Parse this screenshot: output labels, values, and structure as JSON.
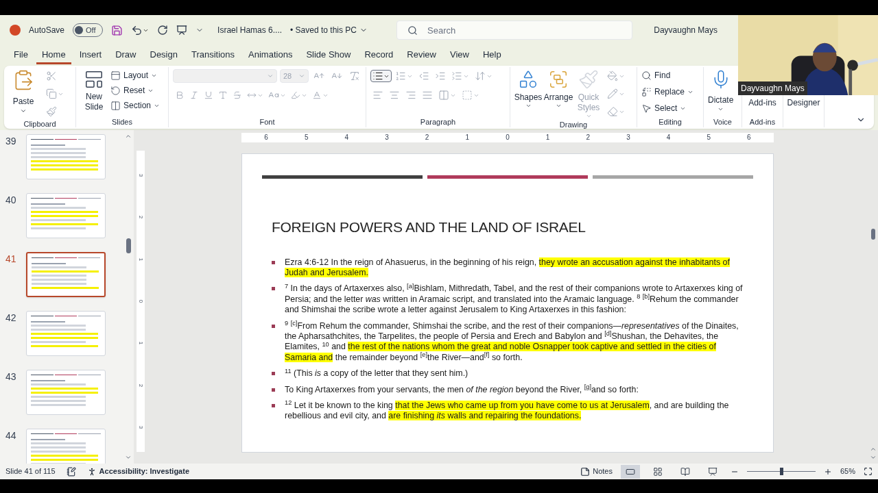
{
  "titlebar": {
    "autosave_label": "AutoSave",
    "autosave": {
      "on": false,
      "label": "Off"
    },
    "file_title": "Israel Hamas 6....",
    "save_status": "• Saved to this PC",
    "search_placeholder": "Search",
    "user": "Dayvaughn Mays"
  },
  "tabs": [
    {
      "label": "File",
      "selected": false
    },
    {
      "label": "Home",
      "selected": true
    },
    {
      "label": "Insert",
      "selected": false
    },
    {
      "label": "Draw",
      "selected": false
    },
    {
      "label": "Design",
      "selected": false
    },
    {
      "label": "Transitions",
      "selected": false
    },
    {
      "label": "Animations",
      "selected": false
    },
    {
      "label": "Slide Show",
      "selected": false
    },
    {
      "label": "Record",
      "selected": false
    },
    {
      "label": "Review",
      "selected": false
    },
    {
      "label": "View",
      "selected": false
    },
    {
      "label": "Help",
      "selected": false
    }
  ],
  "ribbon": [
    {
      "kind": "clipboard",
      "label": "Clipboard",
      "paste": "Paste"
    },
    {
      "kind": "slides",
      "label": "Slides",
      "new_slide": "New Slide",
      "items": [
        "Layout",
        "Reset",
        "Section"
      ]
    },
    {
      "kind": "font",
      "label": "Font",
      "size": "28"
    },
    {
      "kind": "paragraph",
      "label": "Paragraph"
    },
    {
      "kind": "drawing",
      "label": "Drawing",
      "buttons": [
        {
          "label": "Shapes",
          "disabled": false
        },
        {
          "label": "Arrange",
          "disabled": false
        },
        {
          "label": "Quick Styles",
          "disabled": true
        }
      ]
    },
    {
      "kind": "editing",
      "label": "Editing",
      "items": [
        "Find",
        "Replace",
        "Select"
      ]
    },
    {
      "kind": "voice",
      "label": "Voice",
      "button": "Dictate"
    },
    {
      "kind": "addins",
      "label": "Add-ins",
      "button": "Add-ins"
    },
    {
      "kind": "designer",
      "button": "Designer"
    }
  ],
  "thumbnails": [
    {
      "number": "39",
      "selected": false
    },
    {
      "number": "40",
      "selected": false
    },
    {
      "number": "41",
      "selected": true
    },
    {
      "number": "42",
      "selected": false
    },
    {
      "number": "43",
      "selected": false
    },
    {
      "number": "44",
      "selected": false
    }
  ],
  "ruler": {
    "horizontal": [
      "6",
      "5",
      "4",
      "3",
      "2",
      "1",
      "0",
      "1",
      "2",
      "3",
      "4",
      "5",
      "6"
    ],
    "vertical": [
      "3",
      "2",
      "1",
      "0",
      "1",
      "2",
      "3"
    ]
  },
  "slide": {
    "bars": [
      {
        "color": "#404040"
      },
      {
        "color": "#b03a5b"
      },
      {
        "color": "#a6a6a6"
      }
    ],
    "title": "FOREIGN POWERS AND THE LAND OF ISRAEL",
    "paragraphs": [
      {
        "runs": [
          {
            "text": "Ezra 4:6-12  In the reign of Ahasuerus, in the beginning of his reign, ",
            "highlight": false
          },
          {
            "text": "they wrote an accusation against the inhabitants of Judah and Jerusalem.",
            "highlight": true
          }
        ]
      },
      {
        "runs": [
          {
            "text": "$^{7}$ In the days of Artaxerxes also, $^{[a]}$Bishlam, Mithredath, Tabel, and the rest of their companions wrote to Artaxerxes king of Persia; and the letter *was* written in Aramaic script, and translated into the Aramaic language. $^{8}$ $^{[b]}$Rehum the commander and Shimshai the scribe wrote a letter against Jerusalem to King Artaxerxes in this fashion:",
            "highlight": false
          }
        ]
      },
      {
        "runs": [
          {
            "text": "$^{9}$ $^{[c]}$From Rehum the commander, Shimshai the scribe, and the rest of their companions—*representatives* of the Dinaites, the Apharsathchites, the Tarpelites, the people of Persia and Erech and Babylon and $^{[d]}$Shushan, the Dehavites, the Elamites, $^{10}$ and ",
            "highlight": false
          },
          {
            "text": "the rest of the nations whom the great and noble Osnapper took captive and settled in the cities of Samaria and",
            "highlight": true
          },
          {
            "text": " the remainder beyond $^{[e]}$the River—and$^{[f]}$ so forth.",
            "highlight": false
          }
        ]
      },
      {
        "runs": [
          {
            "text": "$^{11}$ (This *is* a copy of the letter that they sent him.)",
            "highlight": false
          }
        ]
      },
      {
        "runs": [
          {
            "text": "To King Artaxerxes from your servants, the men *of the region* beyond the River, $^{[g]}$and so forth:",
            "highlight": false
          }
        ]
      },
      {
        "runs": [
          {
            "text": "$^{12}$ Let it be known to the king ",
            "highlight": false
          },
          {
            "text": "that the Jews who came up from you have come to us at Jerusalem",
            "highlight": true
          },
          {
            "text": ", and are building the rebellious and evil city, and ",
            "highlight": false
          },
          {
            "text": "are finishing *its* walls and repairing the foundations.",
            "highlight": true
          }
        ]
      }
    ]
  },
  "status": {
    "slide_info": "Slide 41 of 115",
    "accessibility": "Accessibility: Investigate",
    "notes": "Notes",
    "views": [
      {
        "kind": "normal",
        "selected": true
      },
      {
        "kind": "sorter",
        "selected": false
      },
      {
        "kind": "reading",
        "selected": false
      },
      {
        "kind": "slideshow",
        "selected": false
      }
    ],
    "zoom": {
      "level": 0.5,
      "label": "65%"
    }
  },
  "webcam": {
    "name": "Dayvaughn Mays"
  }
}
